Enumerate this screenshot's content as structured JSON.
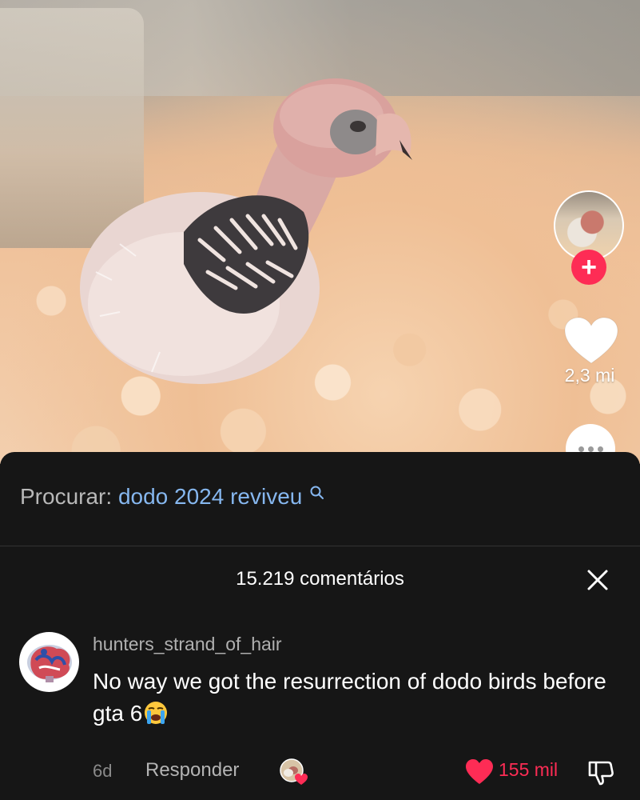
{
  "video": {
    "like_count": "2,3 mi",
    "icons": [
      "creator-avatar",
      "plus-icon",
      "heart-icon",
      "more-icon"
    ]
  },
  "search": {
    "prefix": "Procurar:",
    "term": "dodo 2024 reviveu"
  },
  "comments": {
    "count_label": "15.219 comentários",
    "items": [
      {
        "username": "hunters_strand_of_hair",
        "text": "No way we got the resurrection of dodo birds before gta 6",
        "emoji": "loudly-crying-face",
        "age": "6d",
        "reply_label": "Responder",
        "like_count": "155 mil",
        "liked": true
      }
    ]
  },
  "colors": {
    "accent": "#fe2c55",
    "link": "#86b7ef",
    "sheet_bg": "#161616"
  }
}
